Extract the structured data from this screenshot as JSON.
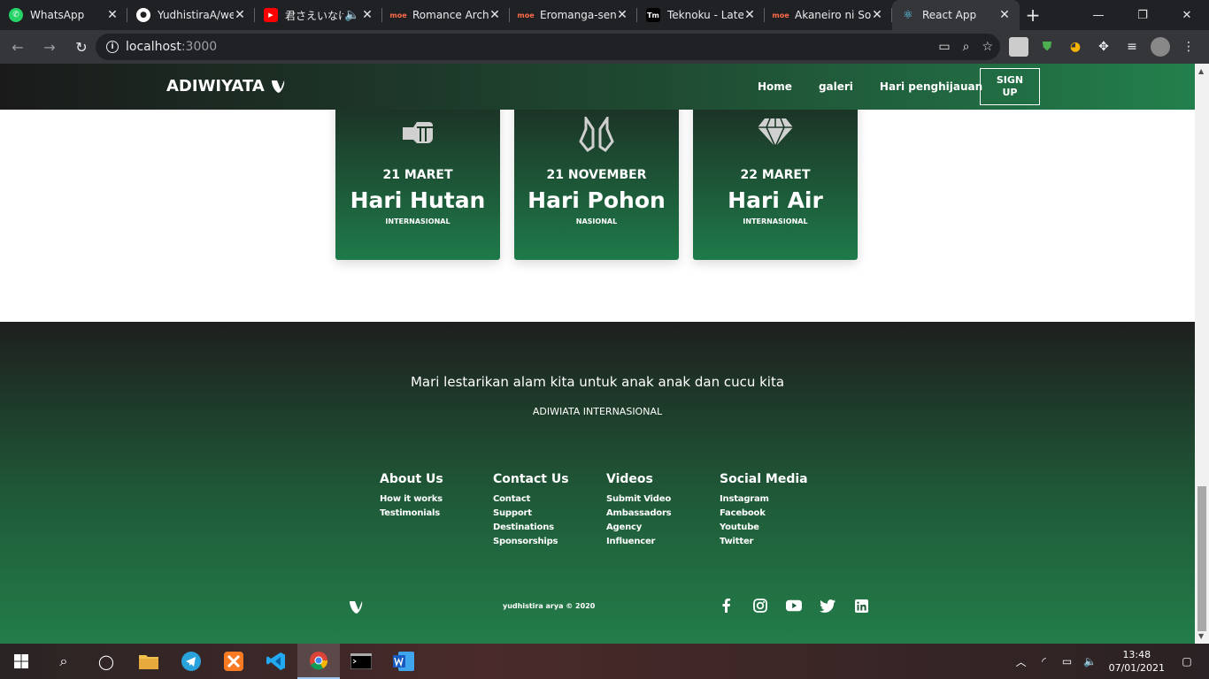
{
  "browser": {
    "tabs": [
      {
        "label": "WhatsApp",
        "icon": "whatsapp-icon",
        "color": "#25d366"
      },
      {
        "label": "YudhistiraA/we",
        "icon": "github-icon",
        "color": "#ffffff"
      },
      {
        "label": "君さえいなけ",
        "icon": "youtube-icon",
        "color": "#ff0000"
      },
      {
        "label": "Romance Archi",
        "icon": "moe-icon",
        "color": "#ff5a5a"
      },
      {
        "label": "Eromanga-sen",
        "icon": "moe-icon",
        "color": "#ff5a5a"
      },
      {
        "label": "Teknoku - Late",
        "icon": "tm-icon",
        "color": "#ffffff"
      },
      {
        "label": "Akaneiro ni So",
        "icon": "moe-icon",
        "color": "#ff5a5a"
      },
      {
        "label": "React App",
        "icon": "react-icon",
        "color": "#61dafb"
      }
    ],
    "url_host": "localhost",
    "url_port": ":3000"
  },
  "nav": {
    "brand": "ADIWIYATA",
    "links": [
      "Home",
      "galeri",
      "Hari penghijauan"
    ],
    "signup_line1": "SIGN",
    "signup_line2": "UP"
  },
  "cards": [
    {
      "date": "21 MARET",
      "title": "Hari Hutan",
      "subtitle": "INTERNASIONAL",
      "icon": "fist-icon"
    },
    {
      "date": "21 NOVEMBER",
      "title": "Hari Pohon",
      "subtitle": "NASIONAL",
      "icon": "hands-icon"
    },
    {
      "date": "22 MARET",
      "title": "Hari Air",
      "subtitle": "INTERNASIONAL",
      "icon": "diamond-icon"
    }
  ],
  "footer": {
    "tagline": "Mari lestarikan alam kita untuk anak anak dan cucu kita",
    "org": "ADIWIATA INTERNASIONAL",
    "columns": [
      {
        "heading": "About Us",
        "links": [
          "How it works",
          "Testimonials"
        ]
      },
      {
        "heading": "Contact Us",
        "links": [
          "Contact",
          "Support",
          "Destinations",
          "Sponsorships"
        ]
      },
      {
        "heading": "Videos",
        "links": [
          "Submit Video",
          "Ambassadors",
          "Agency",
          "Influencer"
        ]
      },
      {
        "heading": "Social Media",
        "links": [
          "Instagram",
          "Facebook",
          "Youtube",
          "Twitter"
        ]
      }
    ],
    "copyright": "yudhistira arya © 2020",
    "social": [
      "facebook-icon",
      "instagram-icon",
      "youtube-icon",
      "twitter-icon",
      "linkedin-icon"
    ]
  },
  "taskbar": {
    "time": "13:48",
    "date": "07/01/2021"
  }
}
